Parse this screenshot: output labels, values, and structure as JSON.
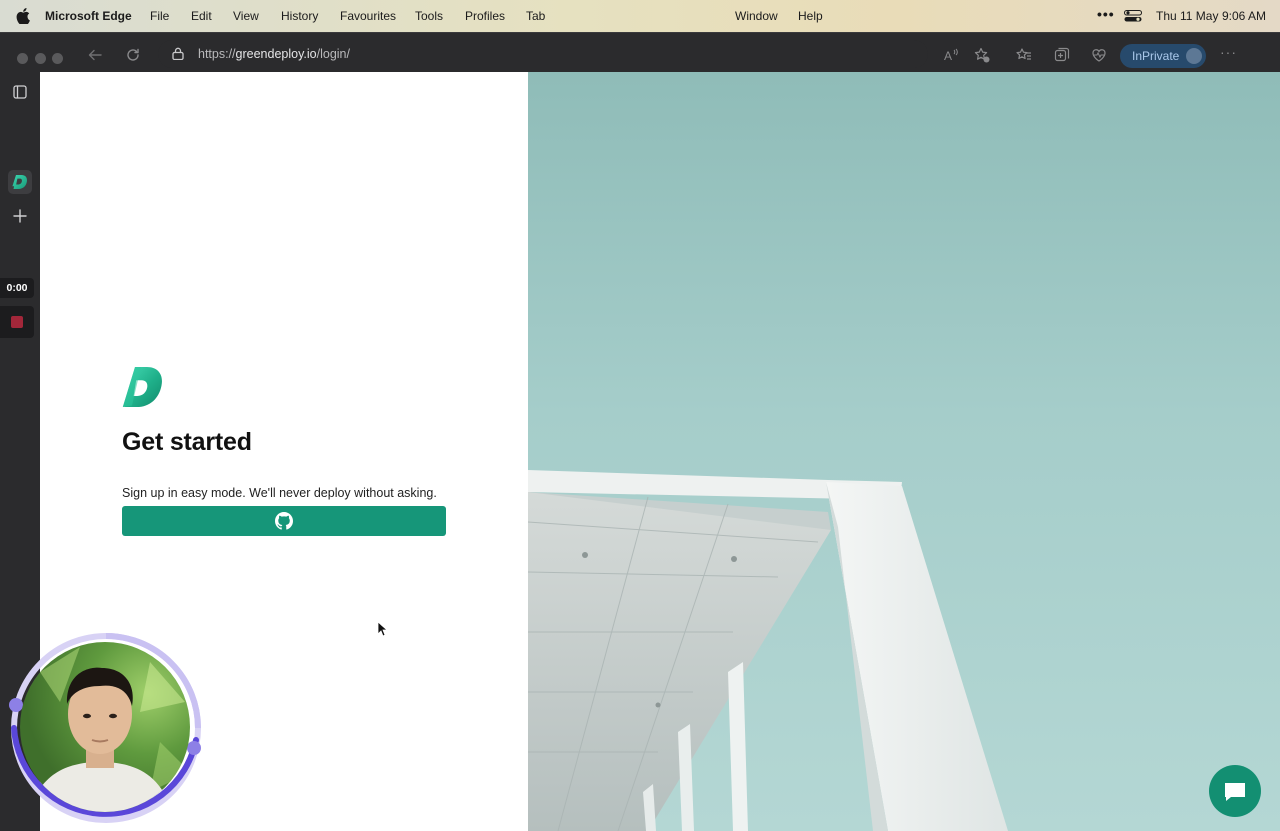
{
  "menubar": {
    "app_name": "Microsoft Edge",
    "items": [
      "File",
      "Edit",
      "View",
      "History",
      "Favourites",
      "Tools",
      "Profiles",
      "Tab",
      "Window",
      "Help"
    ],
    "date": "Thu 11 May",
    "time": "9:06 AM"
  },
  "browser": {
    "url_scheme": "https://",
    "url_host": "greendeploy.io",
    "url_path": "/login/",
    "inprivate_label": "InPrivate",
    "more_label": "···"
  },
  "recorder": {
    "elapsed": "0:00"
  },
  "login": {
    "title": "Get started",
    "subtitle": "Sign up in easy mode. We'll never deploy without asking."
  },
  "colors": {
    "accent": "#169679",
    "chat": "#138f72"
  }
}
